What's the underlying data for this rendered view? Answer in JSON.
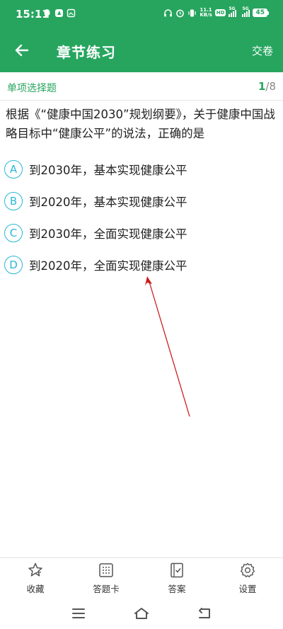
{
  "status_bar": {
    "time": "15:11",
    "net_speed_value": "11.1",
    "net_speed_unit": "KB/s",
    "hd_badge": "HD",
    "signal_1_label": "5G",
    "signal_2_label": "5G",
    "battery": "45"
  },
  "header": {
    "title": "章节练习",
    "submit_label": "交卷"
  },
  "question_meta": {
    "type": "单项选择题",
    "current": "1",
    "total": "/8"
  },
  "question": {
    "text": "根据《“健康中国2030”规划纲要》，关于健康中国战略目标中“健康公平”的说法，正确的是"
  },
  "options": [
    {
      "letter": "A",
      "text": "到2030年，基本实现健康公平"
    },
    {
      "letter": "B",
      "text": "到2020年，基本实现健康公平"
    },
    {
      "letter": "C",
      "text": "到2030年，全面实现健康公平"
    },
    {
      "letter": "D",
      "text": "到2020年，全面实现健康公平"
    }
  ],
  "bottom_nav": [
    {
      "label": "收藏",
      "icon": "star-icon"
    },
    {
      "label": "答题卡",
      "icon": "grid-card-icon"
    },
    {
      "label": "答案",
      "icon": "answer-book-icon"
    },
    {
      "label": "设置",
      "icon": "gear-icon"
    }
  ],
  "colors": {
    "brand_green": "#27a55f",
    "option_accent": "#2bb6d6",
    "annotation_red": "#cc1f1f"
  }
}
